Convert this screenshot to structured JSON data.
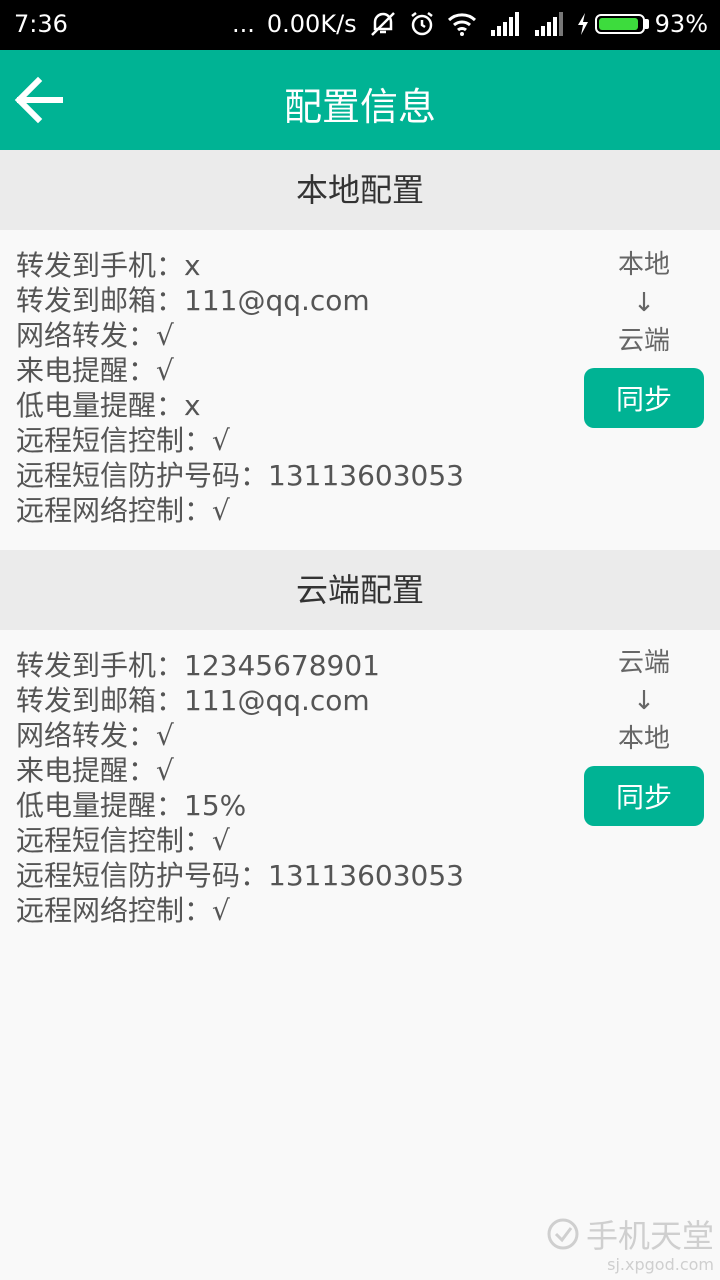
{
  "status_bar": {
    "time": "7:36",
    "dots": "...",
    "network_speed": "0.00K/s",
    "battery_percent": "93%",
    "battery_level": 0.93
  },
  "app_bar": {
    "title": "配置信息",
    "back_icon": "arrow-left-icon"
  },
  "local_config": {
    "header": "本地配置",
    "items": [
      "转发到手机：x",
      "转发到邮箱：111@qq.com",
      "网络转发：√",
      "来电提醒：√",
      "低电量提醒：x",
      "远程短信控制：√",
      "远程短信防护号码：13113603053",
      "远程网络控制：√"
    ],
    "sync_from": "本地",
    "sync_arrow": "↓",
    "sync_to": "云端",
    "sync_button": "同步"
  },
  "cloud_config": {
    "header": "云端配置",
    "items": [
      "转发到手机：12345678901",
      "转发到邮箱：111@qq.com",
      "网络转发：√",
      "来电提醒：√",
      "低电量提醒：15%",
      "远程短信控制：√",
      "远程短信防护号码：13113603053",
      "远程网络控制：√"
    ],
    "sync_from": "云端",
    "sync_arrow": "↓",
    "sync_to": "本地",
    "sync_button": "同步"
  },
  "watermark": {
    "title": "手机天堂",
    "url": "sj.xpgod.com"
  },
  "colors": {
    "accent": "#00b394",
    "header_bg": "#ebebeb",
    "battery": "#3ddc3d"
  }
}
